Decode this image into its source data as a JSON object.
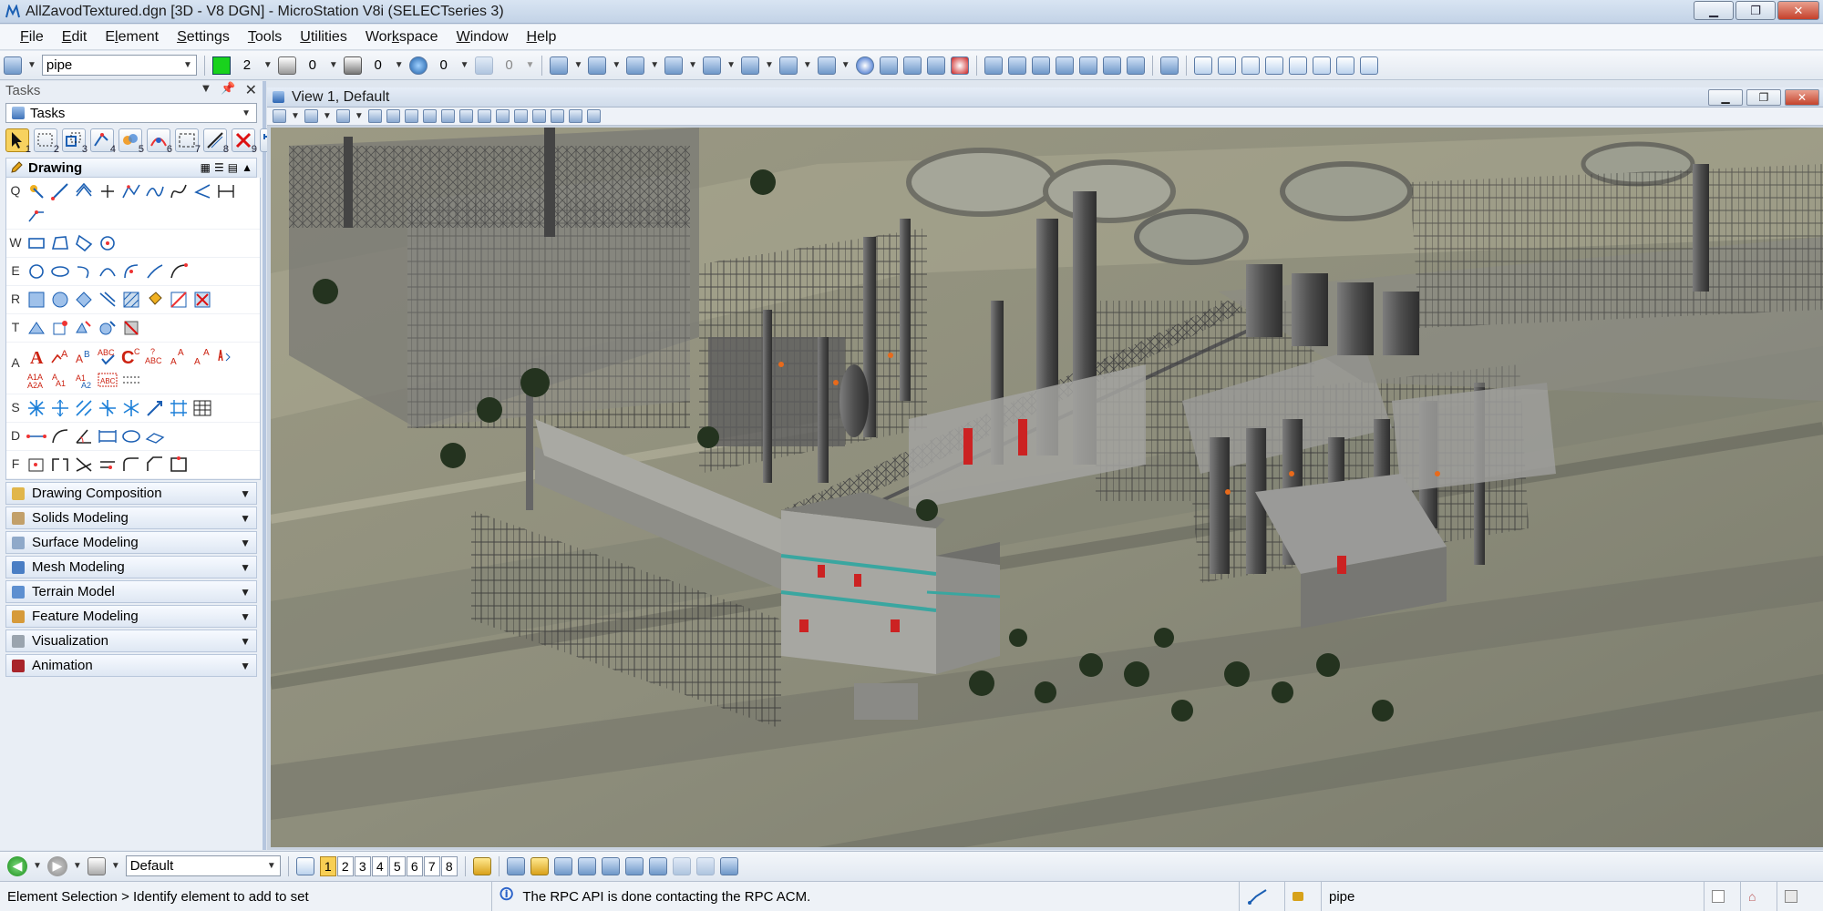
{
  "window": {
    "title": "AllZavodTextured.dgn [3D - V8 DGN] - MicroStation V8i (SELECTseries 3)"
  },
  "menu": {
    "items": [
      {
        "label": "File",
        "accel": "F"
      },
      {
        "label": "Edit",
        "accel": "E"
      },
      {
        "label": "Element",
        "accel": "l"
      },
      {
        "label": "Settings",
        "accel": "S"
      },
      {
        "label": "Tools",
        "accel": "T"
      },
      {
        "label": "Utilities",
        "accel": "U"
      },
      {
        "label": "Workspace",
        "accel": "k"
      },
      {
        "label": "Window",
        "accel": "W"
      },
      {
        "label": "Help",
        "accel": "H"
      }
    ]
  },
  "attributes_toolbar": {
    "level": "pipe",
    "color_value": "2",
    "line_style_value": "0",
    "line_weight_value": "0",
    "transparency_value": "0",
    "priority_value": "0",
    "active_color_hex": "#19d21d"
  },
  "tasks_panel": {
    "title": "Tasks",
    "task_select": "Tasks",
    "toolbox_keys": [
      "1",
      "2",
      "3",
      "4",
      "5",
      "6",
      "7",
      "8",
      "9",
      "0"
    ],
    "drawing_label": "Drawing",
    "row_keys": [
      "Q",
      "W",
      "E",
      "R",
      "T",
      "A",
      "S",
      "D",
      "F"
    ],
    "categories": [
      "Drawing Composition",
      "Solids Modeling",
      "Surface Modeling",
      "Mesh Modeling",
      "Terrain Model",
      "Feature Modeling",
      "Visualization",
      "Animation"
    ]
  },
  "view": {
    "title": "View 1, Default"
  },
  "bottom_toolbar": {
    "view_group": "Default",
    "view_numbers": [
      "1",
      "2",
      "3",
      "4",
      "5",
      "6",
      "7",
      "8"
    ],
    "selected_view": "1"
  },
  "status": {
    "prompt": "Element Selection > Identify element to add to set",
    "message": "The RPC API is done contacting the RPC ACM.",
    "active_level": "pipe"
  }
}
